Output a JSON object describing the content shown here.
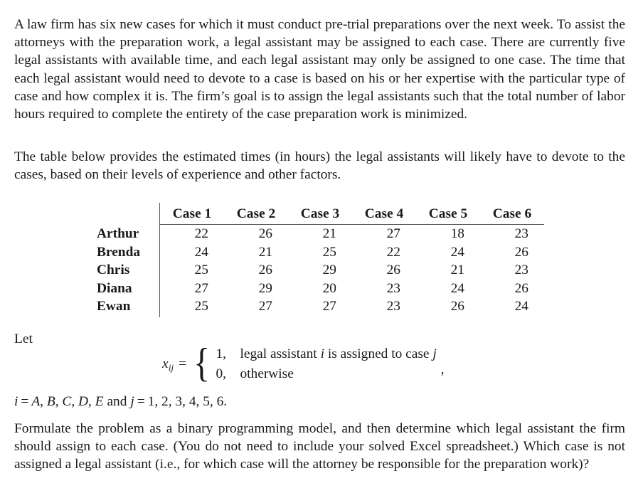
{
  "document": {
    "paragraph_1": "A law firm has six new cases for which it must conduct pre-trial preparations over the next week. To assist the attorneys with the preparation work, a legal assistant may be assigned to each case. There are currently five legal assistants with available time, and each legal assistant may only be assigned to one case. The time that each legal assistant would need to devote to a case is based on his or her expertise with the particular type of case and how complex it is. The firm’s goal is to assign the legal assistants such that the total number of labor hours required to complete the entirety of the case preparation work is minimized.",
    "paragraph_2": "The table below provides the estimated times (in hours) the legal assistants will likely have to devote to the cases, based on their levels of experience and other factors.",
    "let_label": "Let",
    "paragraph_3": "Formulate the problem as a binary programming model, and then determine which legal assistant the firm should assign to each case. (You do not need to include your solved Excel spreadsheet.) Which case is not assigned a legal assistant (i.e., for which case will the attorney be responsible for the preparation work)?"
  },
  "table": {
    "corner_header": "",
    "column_headers": [
      "Case 1",
      "Case 2",
      "Case 3",
      "Case 4",
      "Case 5",
      "Case 6"
    ],
    "row_labels": [
      "Arthur",
      "Brenda",
      "Chris",
      "Diana",
      "Ewan"
    ],
    "rows": [
      {
        "name": "Arthur",
        "values": [
          22,
          26,
          21,
          27,
          18,
          23
        ]
      },
      {
        "name": "Brenda",
        "values": [
          24,
          21,
          25,
          22,
          24,
          26
        ]
      },
      {
        "name": "Chris",
        "values": [
          25,
          26,
          29,
          26,
          21,
          23
        ]
      },
      {
        "name": "Diana",
        "values": [
          27,
          29,
          20,
          23,
          24,
          26
        ]
      },
      {
        "name": "Ewan",
        "values": [
          25,
          27,
          27,
          23,
          26,
          24
        ]
      }
    ],
    "units": "hours",
    "rule_color": "#555555"
  },
  "formula": {
    "variable": "x",
    "subscript": "ij",
    "equals": "=",
    "case_1_value": "1,",
    "case_1_text_before": "legal assistant",
    "case_1_var_i": "i",
    "case_1_text_mid": "is assigned to case",
    "case_1_var_j": "j",
    "case_2_value": "0,",
    "case_2_text": "otherwise",
    "trailing_comma": ",",
    "index_i_var": "i",
    "index_i_equals": "=",
    "index_i_values": "A, B, C, D, E",
    "index_conjunction": "and",
    "index_j_var": "j",
    "index_j_equals": "=",
    "index_j_values": "1, 2, 3, 4, 5, 6."
  },
  "style": {
    "text_color": "#1a1a1a",
    "background": "#ffffff"
  }
}
